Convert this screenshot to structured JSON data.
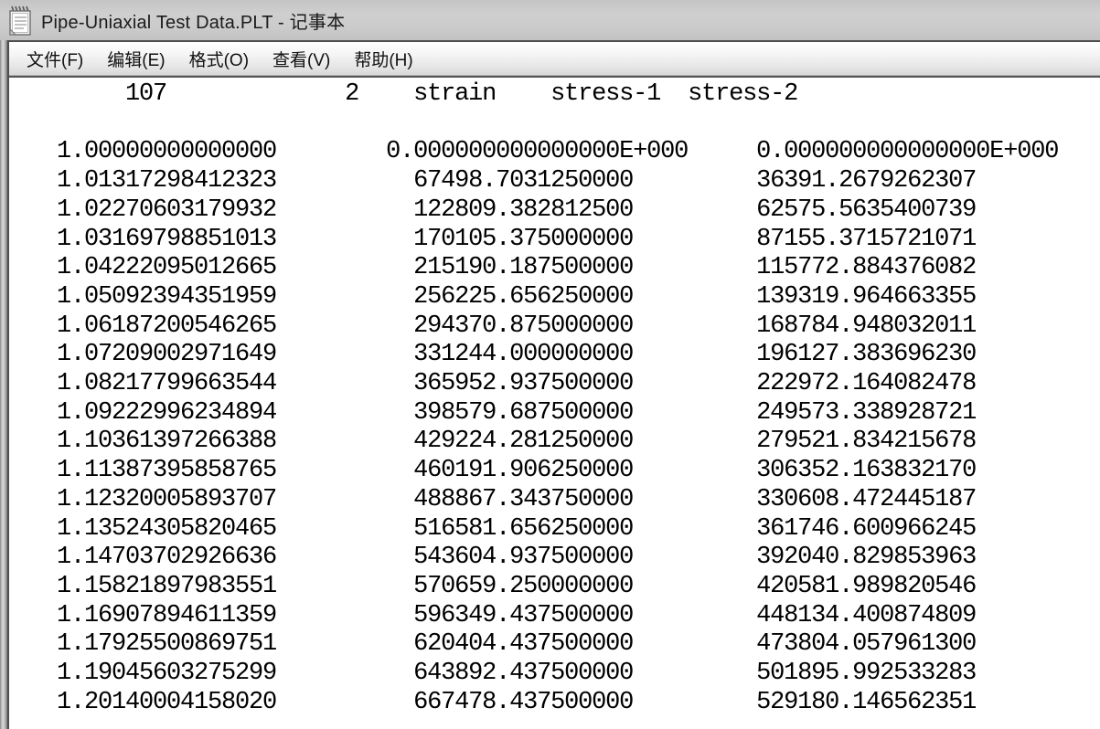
{
  "window": {
    "title": "Pipe-Uniaxial Test Data.PLT - 记事本"
  },
  "menu": {
    "items": [
      {
        "label": "文件(F)"
      },
      {
        "label": "编辑(E)"
      },
      {
        "label": "格式(O)"
      },
      {
        "label": "查看(V)"
      },
      {
        "label": "帮助(H)"
      }
    ]
  },
  "document": {
    "header": {
      "point_count": "107",
      "series_count": "2",
      "columns": [
        "strain",
        "stress-1",
        "stress-2"
      ]
    },
    "rows": [
      [
        "1.00000000000000",
        "0.000000000000000E+000",
        "0.000000000000000E+000"
      ],
      [
        "1.01317298412323",
        "67498.7031250000",
        "36391.2679262307"
      ],
      [
        "1.02270603179932",
        "122809.382812500",
        "62575.5635400739"
      ],
      [
        "1.03169798851013",
        "170105.375000000",
        "87155.3715721071"
      ],
      [
        "1.04222095012665",
        "215190.187500000",
        "115772.884376082"
      ],
      [
        "1.05092394351959",
        "256225.656250000",
        "139319.964663355"
      ],
      [
        "1.06187200546265",
        "294370.875000000",
        "168784.948032011"
      ],
      [
        "1.07209002971649",
        "331244.000000000",
        "196127.383696230"
      ],
      [
        "1.08217799663544",
        "365952.937500000",
        "222972.164082478"
      ],
      [
        "1.09222996234894",
        "398579.687500000",
        "249573.338928721"
      ],
      [
        "1.10361397266388",
        "429224.281250000",
        "279521.834215678"
      ],
      [
        "1.11387395858765",
        "460191.906250000",
        "306352.163832170"
      ],
      [
        "1.12320005893707",
        "488867.343750000",
        "330608.472445187"
      ],
      [
        "1.13524305820465",
        "516581.656250000",
        "361746.600966245"
      ],
      [
        "1.14703702926636",
        "543604.937500000",
        "392040.829853963"
      ],
      [
        "1.15821897983551",
        "570659.250000000",
        "420581.989820546"
      ],
      [
        "1.16907894611359",
        "596349.437500000",
        "448134.400874809"
      ],
      [
        "1.17925500869751",
        "620404.437500000",
        "473804.057961300"
      ],
      [
        "1.19045603275299",
        "643892.437500000",
        "501895.992533283"
      ],
      [
        "1.20140004158020",
        "667478.437500000",
        "529180.146562351"
      ]
    ]
  }
}
